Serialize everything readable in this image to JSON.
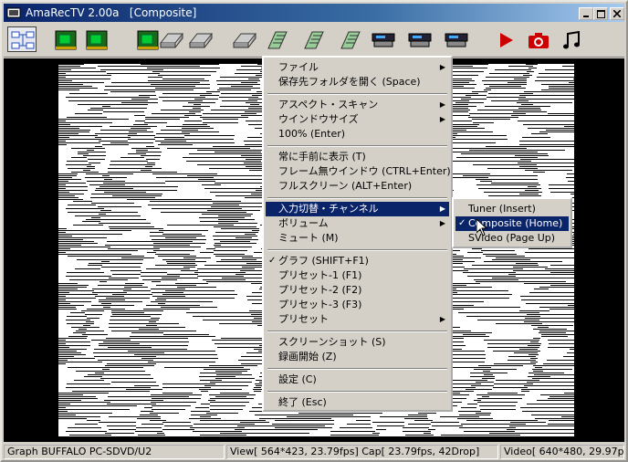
{
  "window": {
    "title": "AmaRecTV 2.00a   [Composite]"
  },
  "toolbar": {
    "buttons": [
      {
        "name": "graph-button-icon"
      },
      {
        "name": "capture-card-1-icon"
      },
      {
        "name": "capture-card-2-icon"
      },
      {
        "name": "capture-card-3-icon"
      },
      {
        "name": "drive-1-icon"
      },
      {
        "name": "drive-2-icon"
      },
      {
        "name": "drive-3-icon"
      },
      {
        "name": "calculator-1-icon"
      },
      {
        "name": "calculator-2-icon"
      },
      {
        "name": "calculator-3-icon"
      },
      {
        "name": "device-1-icon"
      },
      {
        "name": "device-2-icon"
      },
      {
        "name": "device-3-icon"
      },
      {
        "name": "play-icon"
      },
      {
        "name": "camera-icon"
      },
      {
        "name": "music-icon"
      }
    ]
  },
  "context_menu": {
    "items": [
      {
        "label": "ファイル"
      },
      {
        "label": "保存先フォルダを開く (Space)"
      },
      {
        "label": "アスペクト・スキャン"
      },
      {
        "label": "ウインドウサイズ"
      },
      {
        "label": "100% (Enter)"
      },
      {
        "label": "常に手前に表示 (T)"
      },
      {
        "label": "フレーム無ウインドウ (CTRL+Enter)"
      },
      {
        "label": "フルスクリーン (ALT+Enter)"
      },
      {
        "label": "入力切替・チャンネル"
      },
      {
        "label": "ボリューム"
      },
      {
        "label": "ミュート (M)"
      },
      {
        "label": "グラフ (SHIFT+F1)"
      },
      {
        "label": "プリセット-1 (F1)"
      },
      {
        "label": "プリセット-2 (F2)"
      },
      {
        "label": "プリセット-3 (F3)"
      },
      {
        "label": "プリセット"
      },
      {
        "label": "スクリーンショット (S)"
      },
      {
        "label": "録画開始 (Z)"
      },
      {
        "label": "設定 (C)"
      },
      {
        "label": "終了 (Esc)"
      }
    ]
  },
  "submenu": {
    "items": [
      {
        "label": "Tuner (Insert)"
      },
      {
        "label": "Composite (Home)"
      },
      {
        "label": "SVideo (Page Up)"
      }
    ]
  },
  "status": {
    "graph": "Graph BUFFALO PC-SDVD/U2",
    "view": "View[ 564*423, 23.79fps]  Cap[ 23.79fps, 42Drop]",
    "video": "Video[ 640*480, 29.97p,"
  },
  "colors": {
    "highlight": "#0a246a",
    "titlebar": "#0a246a",
    "face": "#d4d0c8"
  }
}
